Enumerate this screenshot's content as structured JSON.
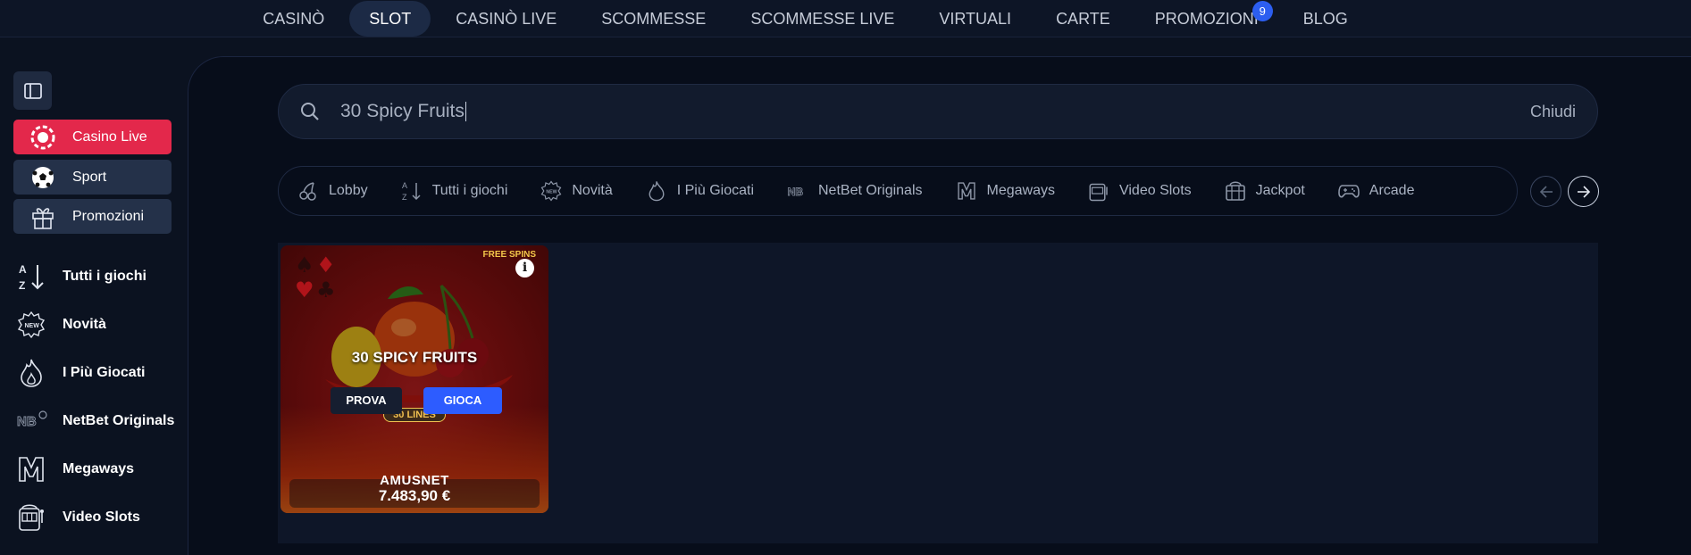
{
  "topnav": {
    "items": [
      {
        "label": "CASINÒ"
      },
      {
        "label": "SLOT"
      },
      {
        "label": "CASINÒ LIVE"
      },
      {
        "label": "SCOMMESSE"
      },
      {
        "label": "SCOMMESSE LIVE"
      },
      {
        "label": "VIRTUALI"
      },
      {
        "label": "CARTE"
      },
      {
        "label": "PROMOZIONI",
        "badge": "9"
      },
      {
        "label": "BLOG"
      }
    ],
    "active": "SLOT"
  },
  "sidebar": {
    "quick_links": [
      {
        "label": "Casino Live",
        "icon": "casino-chip-icon",
        "color": "#e3284b"
      },
      {
        "label": "Sport",
        "icon": "soccer-ball-icon"
      },
      {
        "label": "Promozioni",
        "icon": "gift-icon"
      }
    ],
    "items": [
      {
        "label": "Tutti i giochi",
        "icon": "az-sort-icon"
      },
      {
        "label": "Novità",
        "icon": "new-badge-icon"
      },
      {
        "label": "I Più Giocati",
        "icon": "flame-icon"
      },
      {
        "label": "NetBet Originals",
        "icon": "netbet-originals-icon"
      },
      {
        "label": "Megaways",
        "icon": "megaways-icon"
      },
      {
        "label": "Video Slots",
        "icon": "slot-machine-icon"
      }
    ]
  },
  "search": {
    "value": "30 Spicy Fruits",
    "close_label": "Chiudi"
  },
  "categories": [
    {
      "label": "Lobby",
      "icon": "cherry-icon"
    },
    {
      "label": "Tutti i giochi",
      "icon": "az-sort-icon"
    },
    {
      "label": "Novità",
      "icon": "new-badge-icon"
    },
    {
      "label": "I Più Giocati",
      "icon": "flame-icon"
    },
    {
      "label": "NetBet Originals",
      "icon": "netbet-originals-icon"
    },
    {
      "label": "Megaways",
      "icon": "megaways-icon"
    },
    {
      "label": "Video Slots",
      "icon": "slot-machine-icon"
    },
    {
      "label": "Jackpot",
      "icon": "jackpot-icon"
    },
    {
      "label": "Arcade",
      "icon": "gamepad-icon"
    }
  ],
  "game": {
    "title": "30 SPICY FRUITS",
    "try_label": "PROVA",
    "play_label": "GIOCA",
    "provider": "AMUSNET",
    "jackpot": "7.483,90 €",
    "logo_lines": "30 LINES",
    "logo_badge": "FREE SPINS"
  },
  "colors": {
    "accent": "#2d5cff",
    "badge": "#2c5ef0",
    "casino_live": "#e3284b"
  }
}
